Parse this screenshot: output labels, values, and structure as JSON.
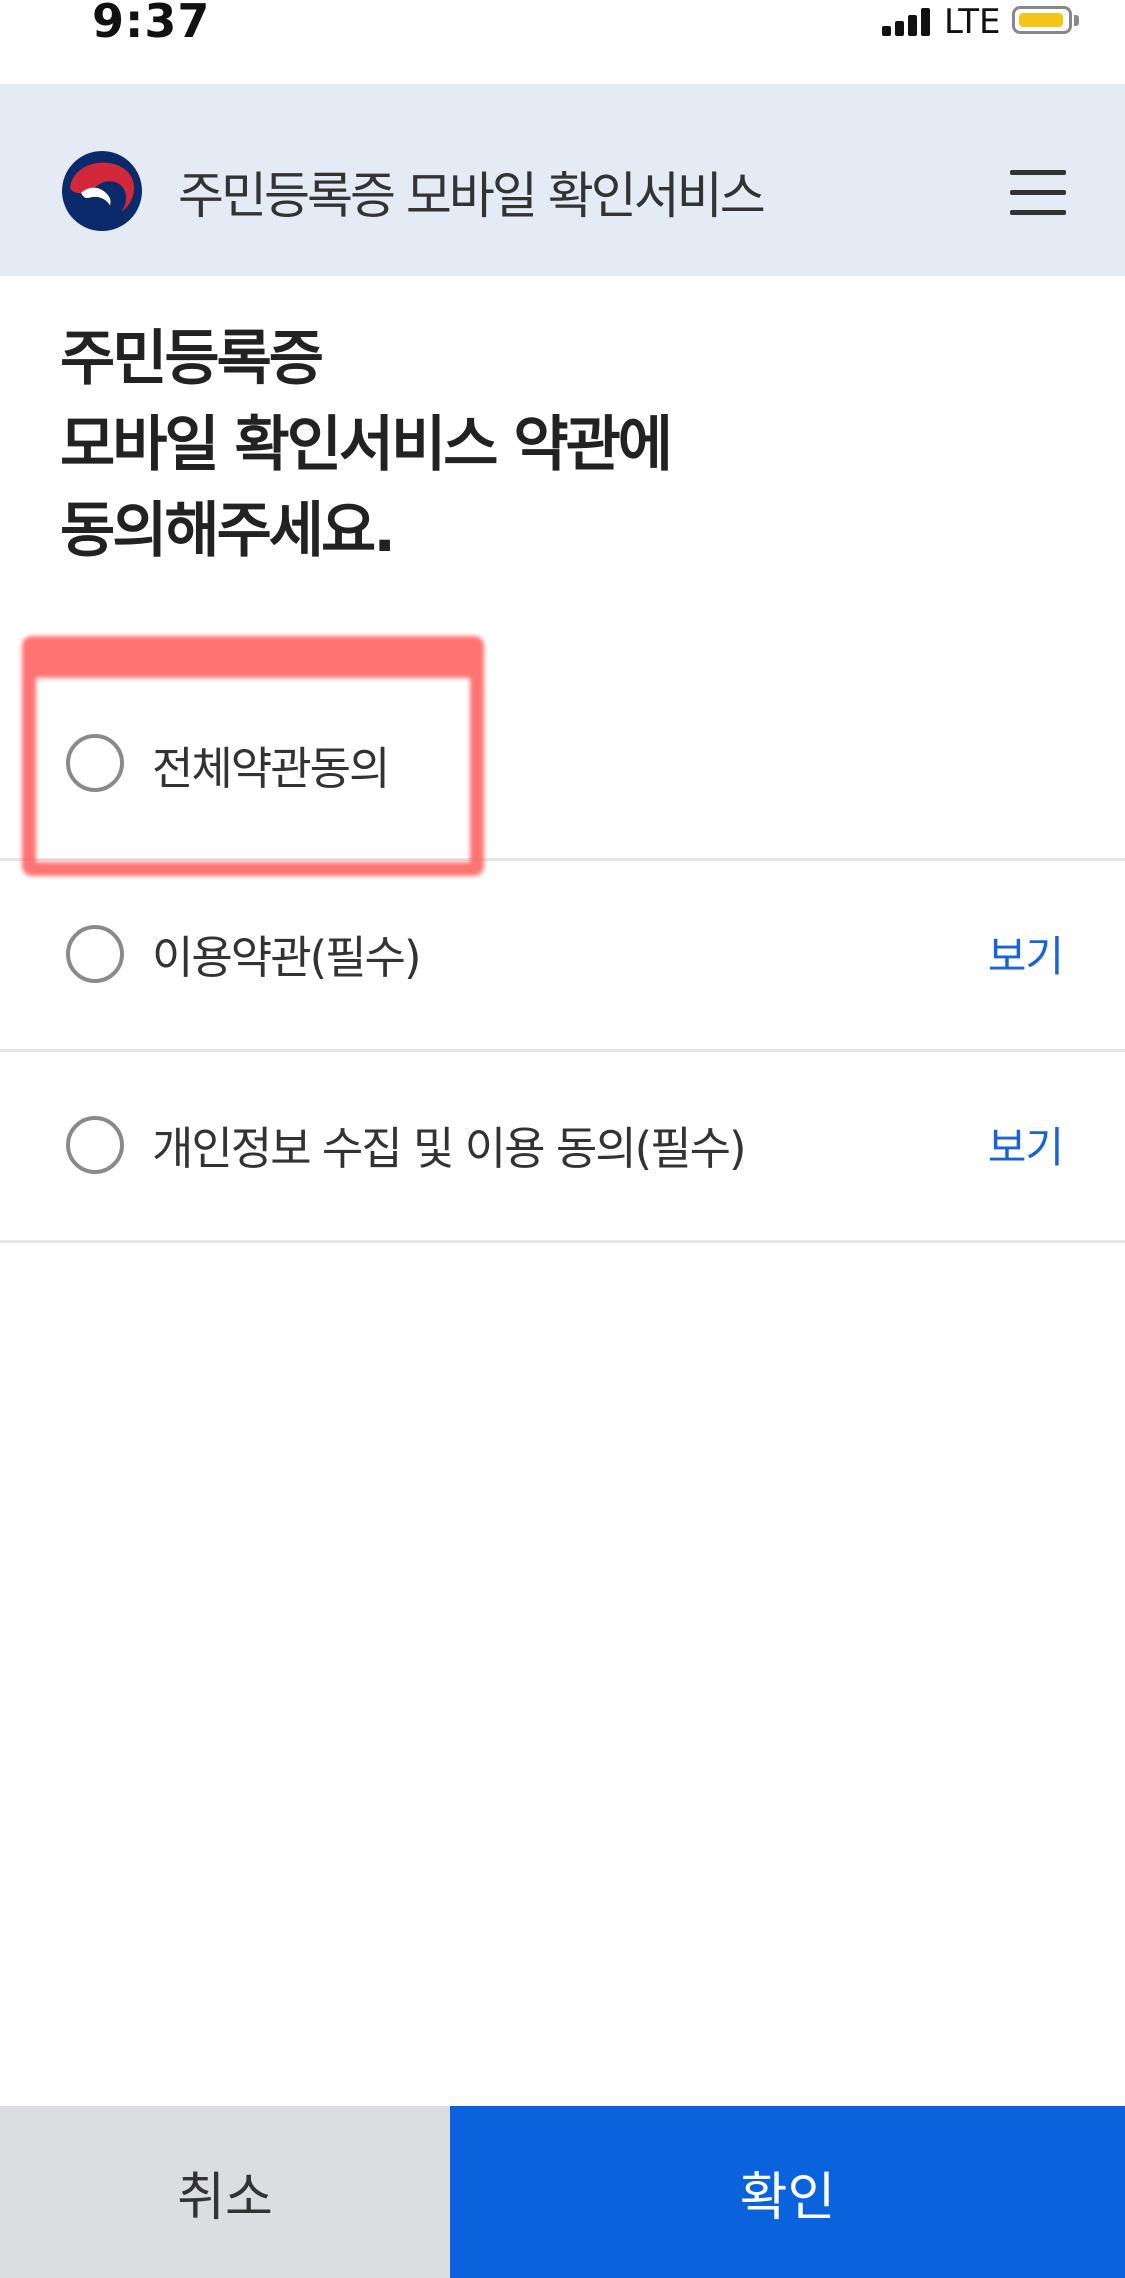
{
  "status_bar": {
    "time": "9:37",
    "network": "LTE"
  },
  "header": {
    "title": "주민등록증 모바일 확인서비스",
    "logo_icon": "taegeuk-logo-icon",
    "menu_icon": "hamburger-menu-icon"
  },
  "page": {
    "title_lines": [
      "주민등록증",
      "모바일 확인서비스 약관에",
      "동의해주세요."
    ]
  },
  "agreements": [
    {
      "label": "전체약관동의",
      "checked": false,
      "view_label": ""
    },
    {
      "label": "이용약관(필수)",
      "checked": false,
      "view_label": "보기"
    },
    {
      "label": "개인정보 수집 및 이용 동의(필수)",
      "checked": false,
      "view_label": "보기"
    }
  ],
  "buttons": {
    "cancel": "취소",
    "confirm": "확인"
  },
  "colors": {
    "accent": "#0b62dd",
    "link": "#1a63d6",
    "header_bg": "#e4ebf4",
    "highlight": "#ff5a5a"
  }
}
